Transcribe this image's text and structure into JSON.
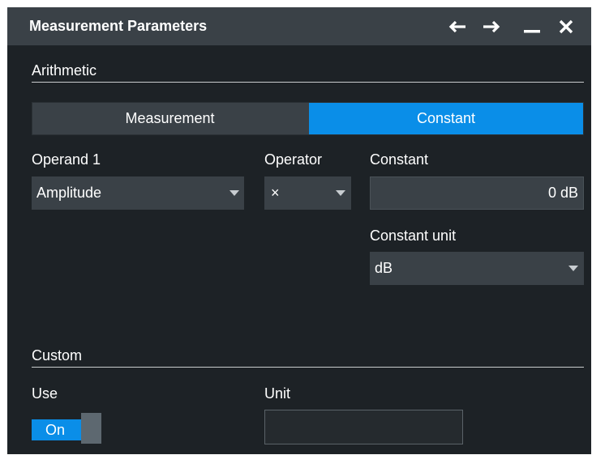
{
  "window": {
    "title": "Measurement Parameters",
    "controls": [
      "back-arrow",
      "forward-arrow",
      "minimize",
      "close"
    ]
  },
  "arithmetic": {
    "section_label": "Arithmetic",
    "mode_options": [
      "Measurement",
      "Constant"
    ],
    "mode_selected": "Constant",
    "operand1": {
      "label": "Operand 1",
      "value": "Amplitude"
    },
    "operator": {
      "label": "Operator",
      "value": "×"
    },
    "constant": {
      "label": "Constant",
      "value": "0 dB"
    },
    "constant_unit": {
      "label": "Constant unit",
      "value": "dB"
    }
  },
  "custom": {
    "section_label": "Custom",
    "use": {
      "label": "Use",
      "state": "On"
    },
    "unit": {
      "label": "Unit",
      "value": ""
    }
  },
  "colors": {
    "accent": "#0a8ee8",
    "titlebar": "#3a4147",
    "background": "#1d2226"
  }
}
